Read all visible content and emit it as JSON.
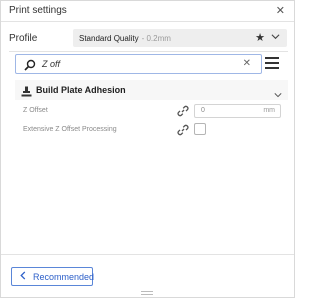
{
  "window": {
    "title": "Print settings"
  },
  "profile": {
    "label": "Profile",
    "selected_name": "Standard Quality",
    "selected_sub": "- 0.2mm",
    "favorite_icon": "star-icon",
    "dropdown_icon": "chevron-down-icon"
  },
  "search": {
    "value": "Z off",
    "search_icon": "search-icon",
    "clear_icon": "close-icon",
    "menu_icon": "hamburger-menu-icon"
  },
  "category": {
    "title": "Build Plate Adhesion",
    "icon": "build-plate-adhesion-icon",
    "expanded": true
  },
  "settings": [
    {
      "label": "Z Offset",
      "value": "0",
      "unit": "mm",
      "linked_icon": "link-icon"
    },
    {
      "label": "Extensive Z Offset Processing",
      "checked": false,
      "linked_icon": "link-icon"
    }
  ],
  "footer": {
    "recommended_label": "Recommended"
  },
  "colors": {
    "accent": "#2c5fc9",
    "search_border": "#9fb7e6"
  }
}
